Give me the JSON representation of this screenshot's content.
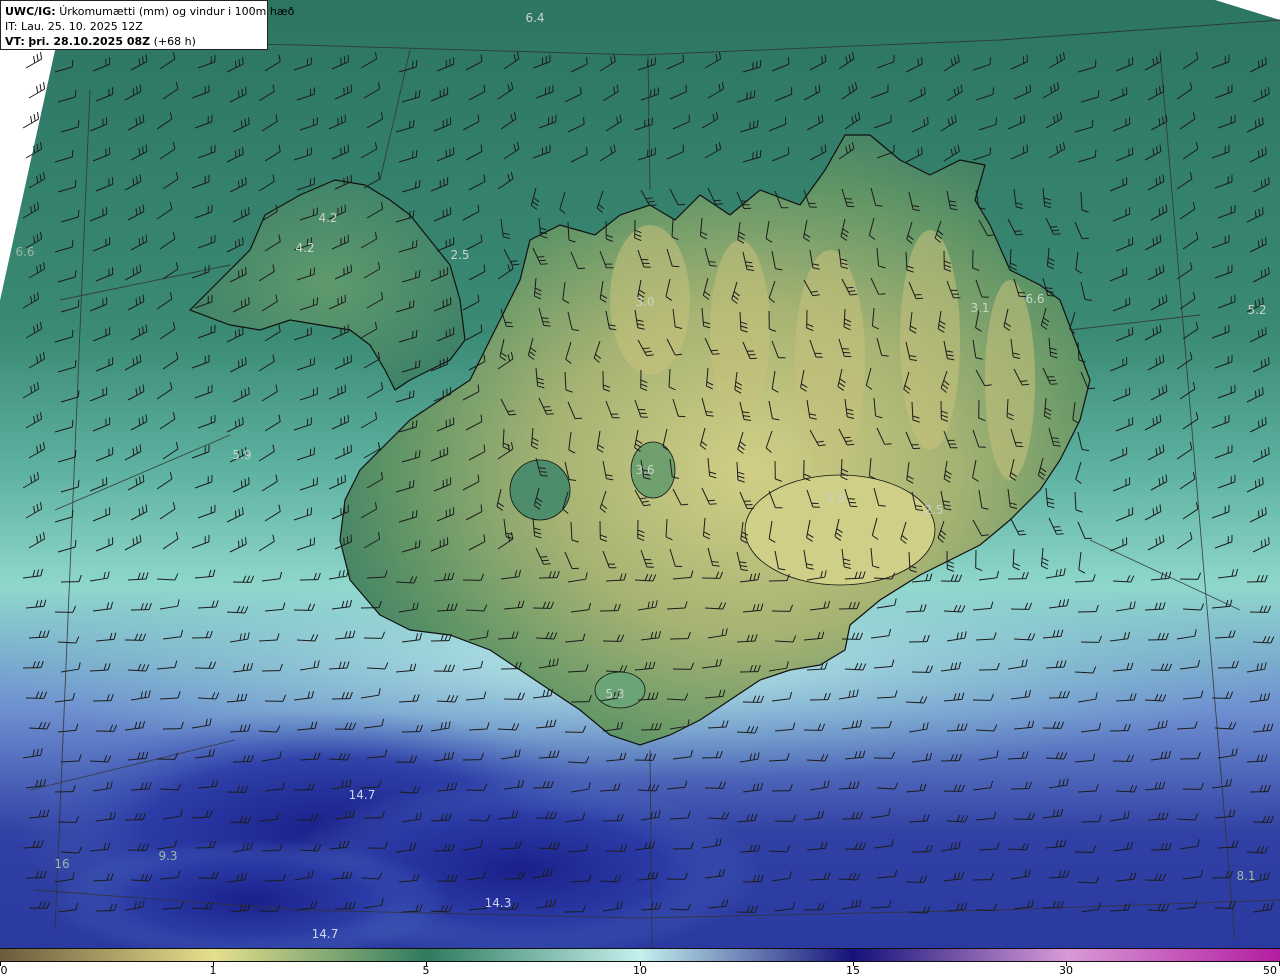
{
  "header": {
    "product": "UWC/IG:",
    "field": "Úrkomumætti (mm) og vindur i 100m hæð",
    "it_label": "IT: Lau. 25. 10. 2025 12Z",
    "vt_prefix": "VT:",
    "vt_value": "þri. 28.10.2025 08Z",
    "vt_lead": "(+68 h)"
  },
  "map_values": [
    {
      "id": "v1",
      "text": "6.4",
      "tone": "light"
    },
    {
      "id": "v2",
      "text": "4.2",
      "tone": "light"
    },
    {
      "id": "v3",
      "text": "4.2",
      "tone": "light"
    },
    {
      "id": "v4",
      "text": "2.5",
      "tone": "light"
    },
    {
      "id": "v5",
      "text": "3.0",
      "tone": "light"
    },
    {
      "id": "v6",
      "text": "3.1",
      "tone": "light"
    },
    {
      "id": "v7",
      "text": "6.6",
      "tone": "light"
    },
    {
      "id": "v8",
      "text": "5.2",
      "tone": "light"
    },
    {
      "id": "v9",
      "text": "6.6",
      "tone": "faint"
    },
    {
      "id": "v10",
      "text": "5.9",
      "tone": "light"
    },
    {
      "id": "v11",
      "text": "3.6",
      "tone": "light"
    },
    {
      "id": "v12",
      "text": "2.8",
      "tone": "light"
    },
    {
      "id": "v13",
      "text": "2.5",
      "tone": "light"
    },
    {
      "id": "v14",
      "text": "5.3",
      "tone": "light"
    },
    {
      "id": "v15",
      "text": "14.7",
      "tone": "dark"
    },
    {
      "id": "v16",
      "text": "9.3",
      "tone": "faint"
    },
    {
      "id": "v17",
      "text": "16",
      "tone": "faint"
    },
    {
      "id": "v18",
      "text": "14.3",
      "tone": "dark"
    },
    {
      "id": "v19",
      "text": "14.7",
      "tone": "dark"
    },
    {
      "id": "v20",
      "text": "8.1",
      "tone": "faint"
    }
  ],
  "colorbar": {
    "unit": "mm",
    "stops": [
      {
        "value": 0,
        "color": "#6b5a3c"
      },
      {
        "value": 1,
        "color": "#e6e08c"
      },
      {
        "value": 5,
        "color": "#2f7a5f"
      },
      {
        "value": 10,
        "color": "#c4f0ee"
      },
      {
        "value": 15,
        "color": "#14127a"
      },
      {
        "value": 30,
        "color": "#d89ad6"
      },
      {
        "value": 50,
        "color": "#b21ca0"
      }
    ],
    "ticks": [
      "0",
      "1",
      "5",
      "10",
      "15",
      "30",
      "50"
    ]
  },
  "colors": {
    "sea": "#2e7b66",
    "land_high": "#c4c27a",
    "heavy_precip": "#1f2d92",
    "moderate_precip": "#9ae0d8",
    "coastline": "#111111",
    "wind_barb": "#222222",
    "grid_line": "#333333"
  }
}
